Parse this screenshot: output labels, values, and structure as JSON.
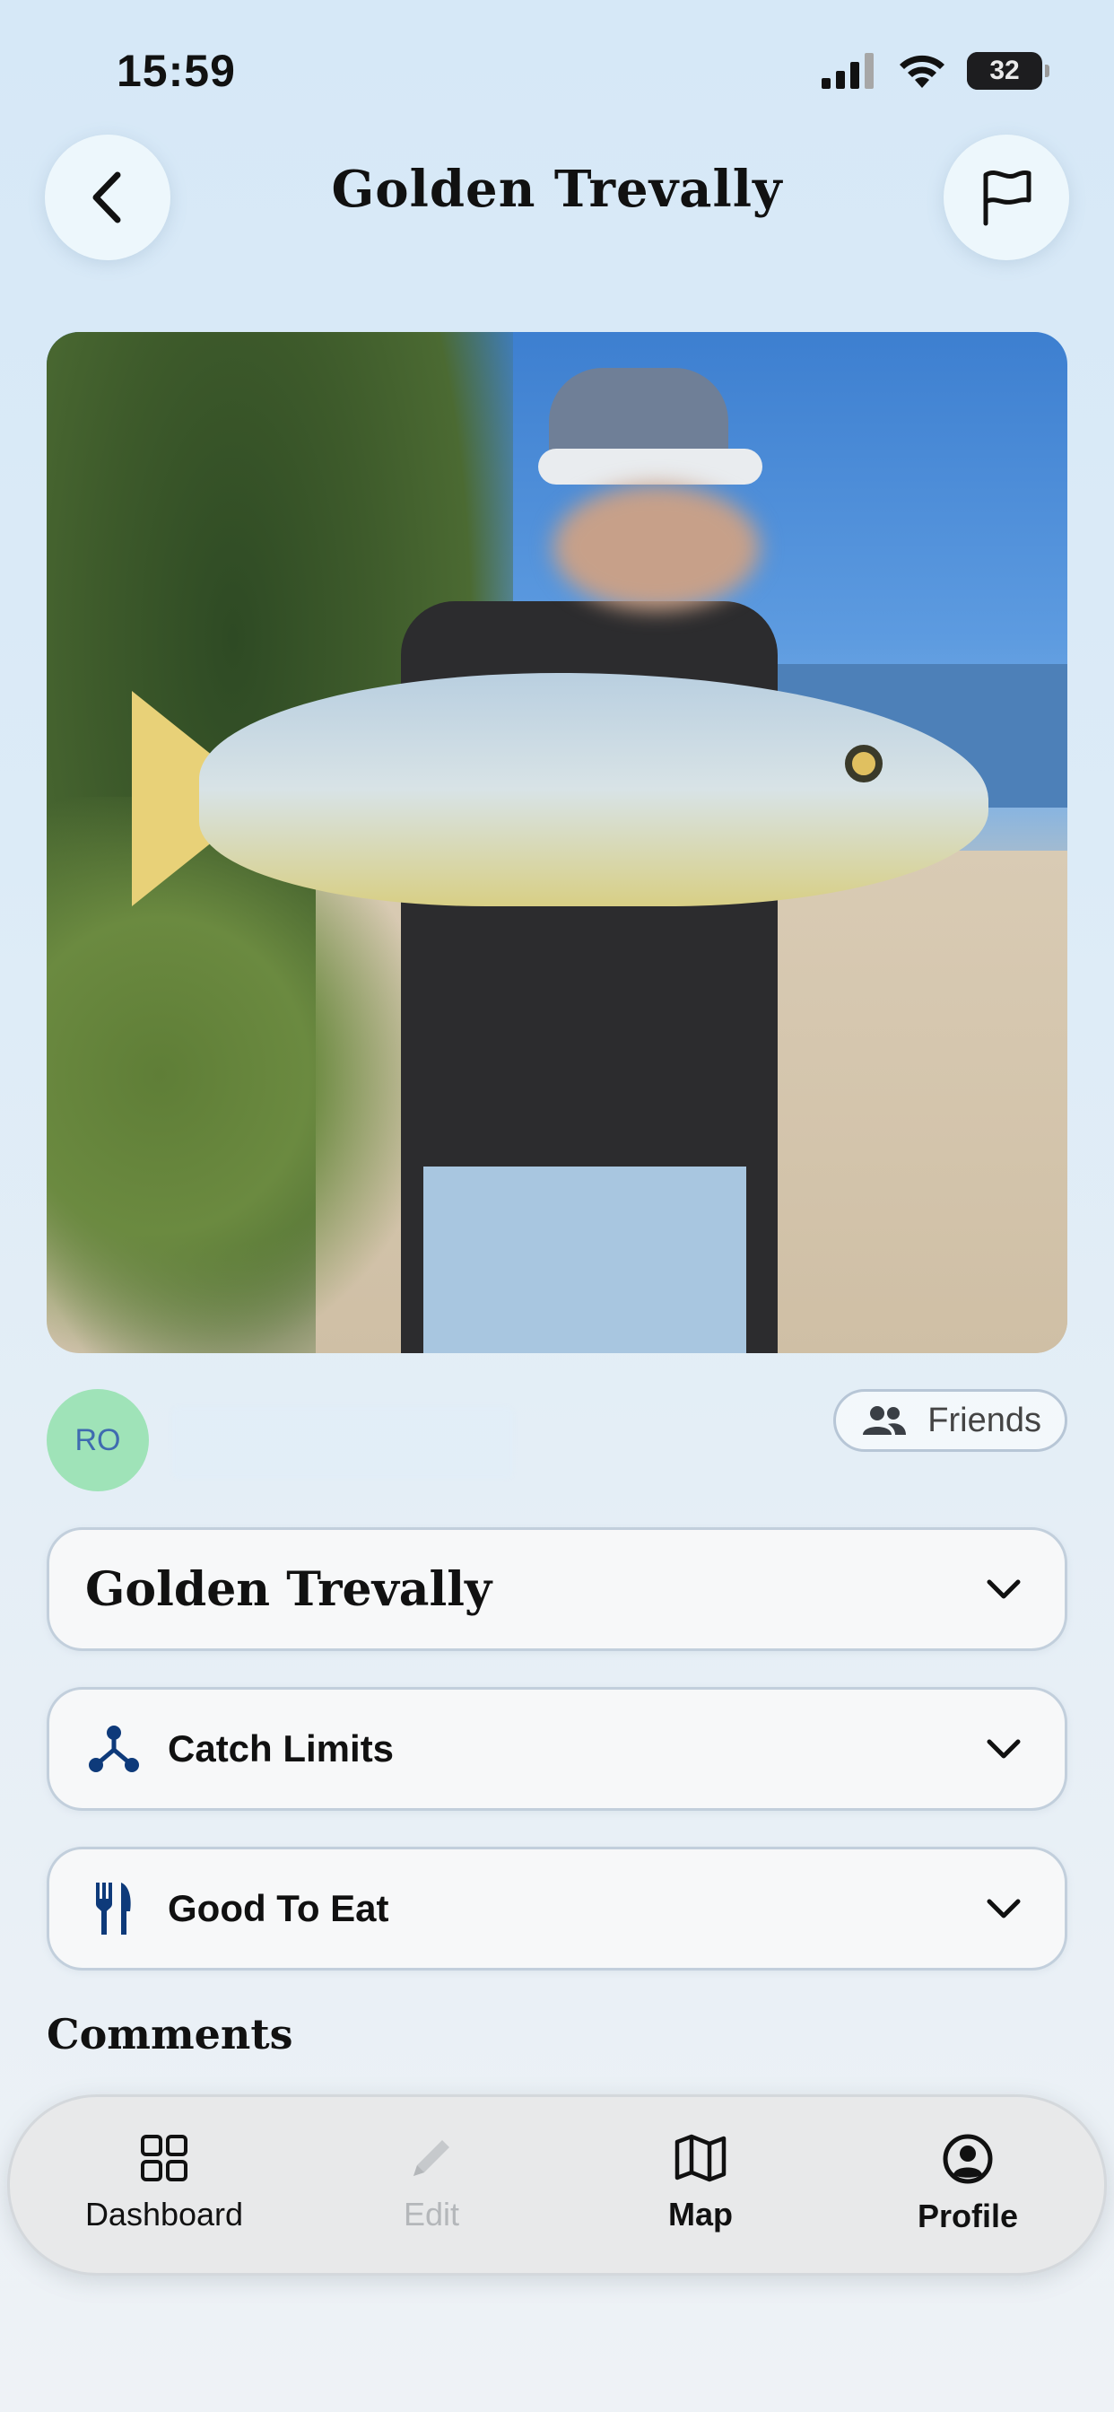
{
  "status_bar": {
    "time": "15:59",
    "battery": "32"
  },
  "header": {
    "title": "Golden Trevally",
    "back_icon": "chevron-left-icon",
    "report_icon": "flag-icon"
  },
  "photo": {
    "description": ""
  },
  "user": {
    "initials": "RO",
    "visibility_label": "Friends",
    "avatar_color": "#9fe3b8"
  },
  "sections": [
    {
      "label": "Golden Trevally",
      "icon": null
    },
    {
      "label": "Catch Limits",
      "icon": "share-nodes-icon"
    },
    {
      "label": "Good To Eat",
      "icon": "fork-knife-icon"
    }
  ],
  "comments": {
    "heading": "Comments"
  },
  "tab_bar": {
    "items": [
      {
        "label": "Dashboard",
        "icon": "grid-icon",
        "enabled": true
      },
      {
        "label": "Edit",
        "icon": "pencil-icon",
        "enabled": false
      },
      {
        "label": "Map",
        "icon": "map-icon",
        "enabled": true
      },
      {
        "label": "Profile",
        "icon": "user-circle-icon",
        "enabled": true
      }
    ]
  },
  "colors": {
    "icon_blue": "#0e3a7a",
    "disabled_gray": "#b4b7ba"
  }
}
